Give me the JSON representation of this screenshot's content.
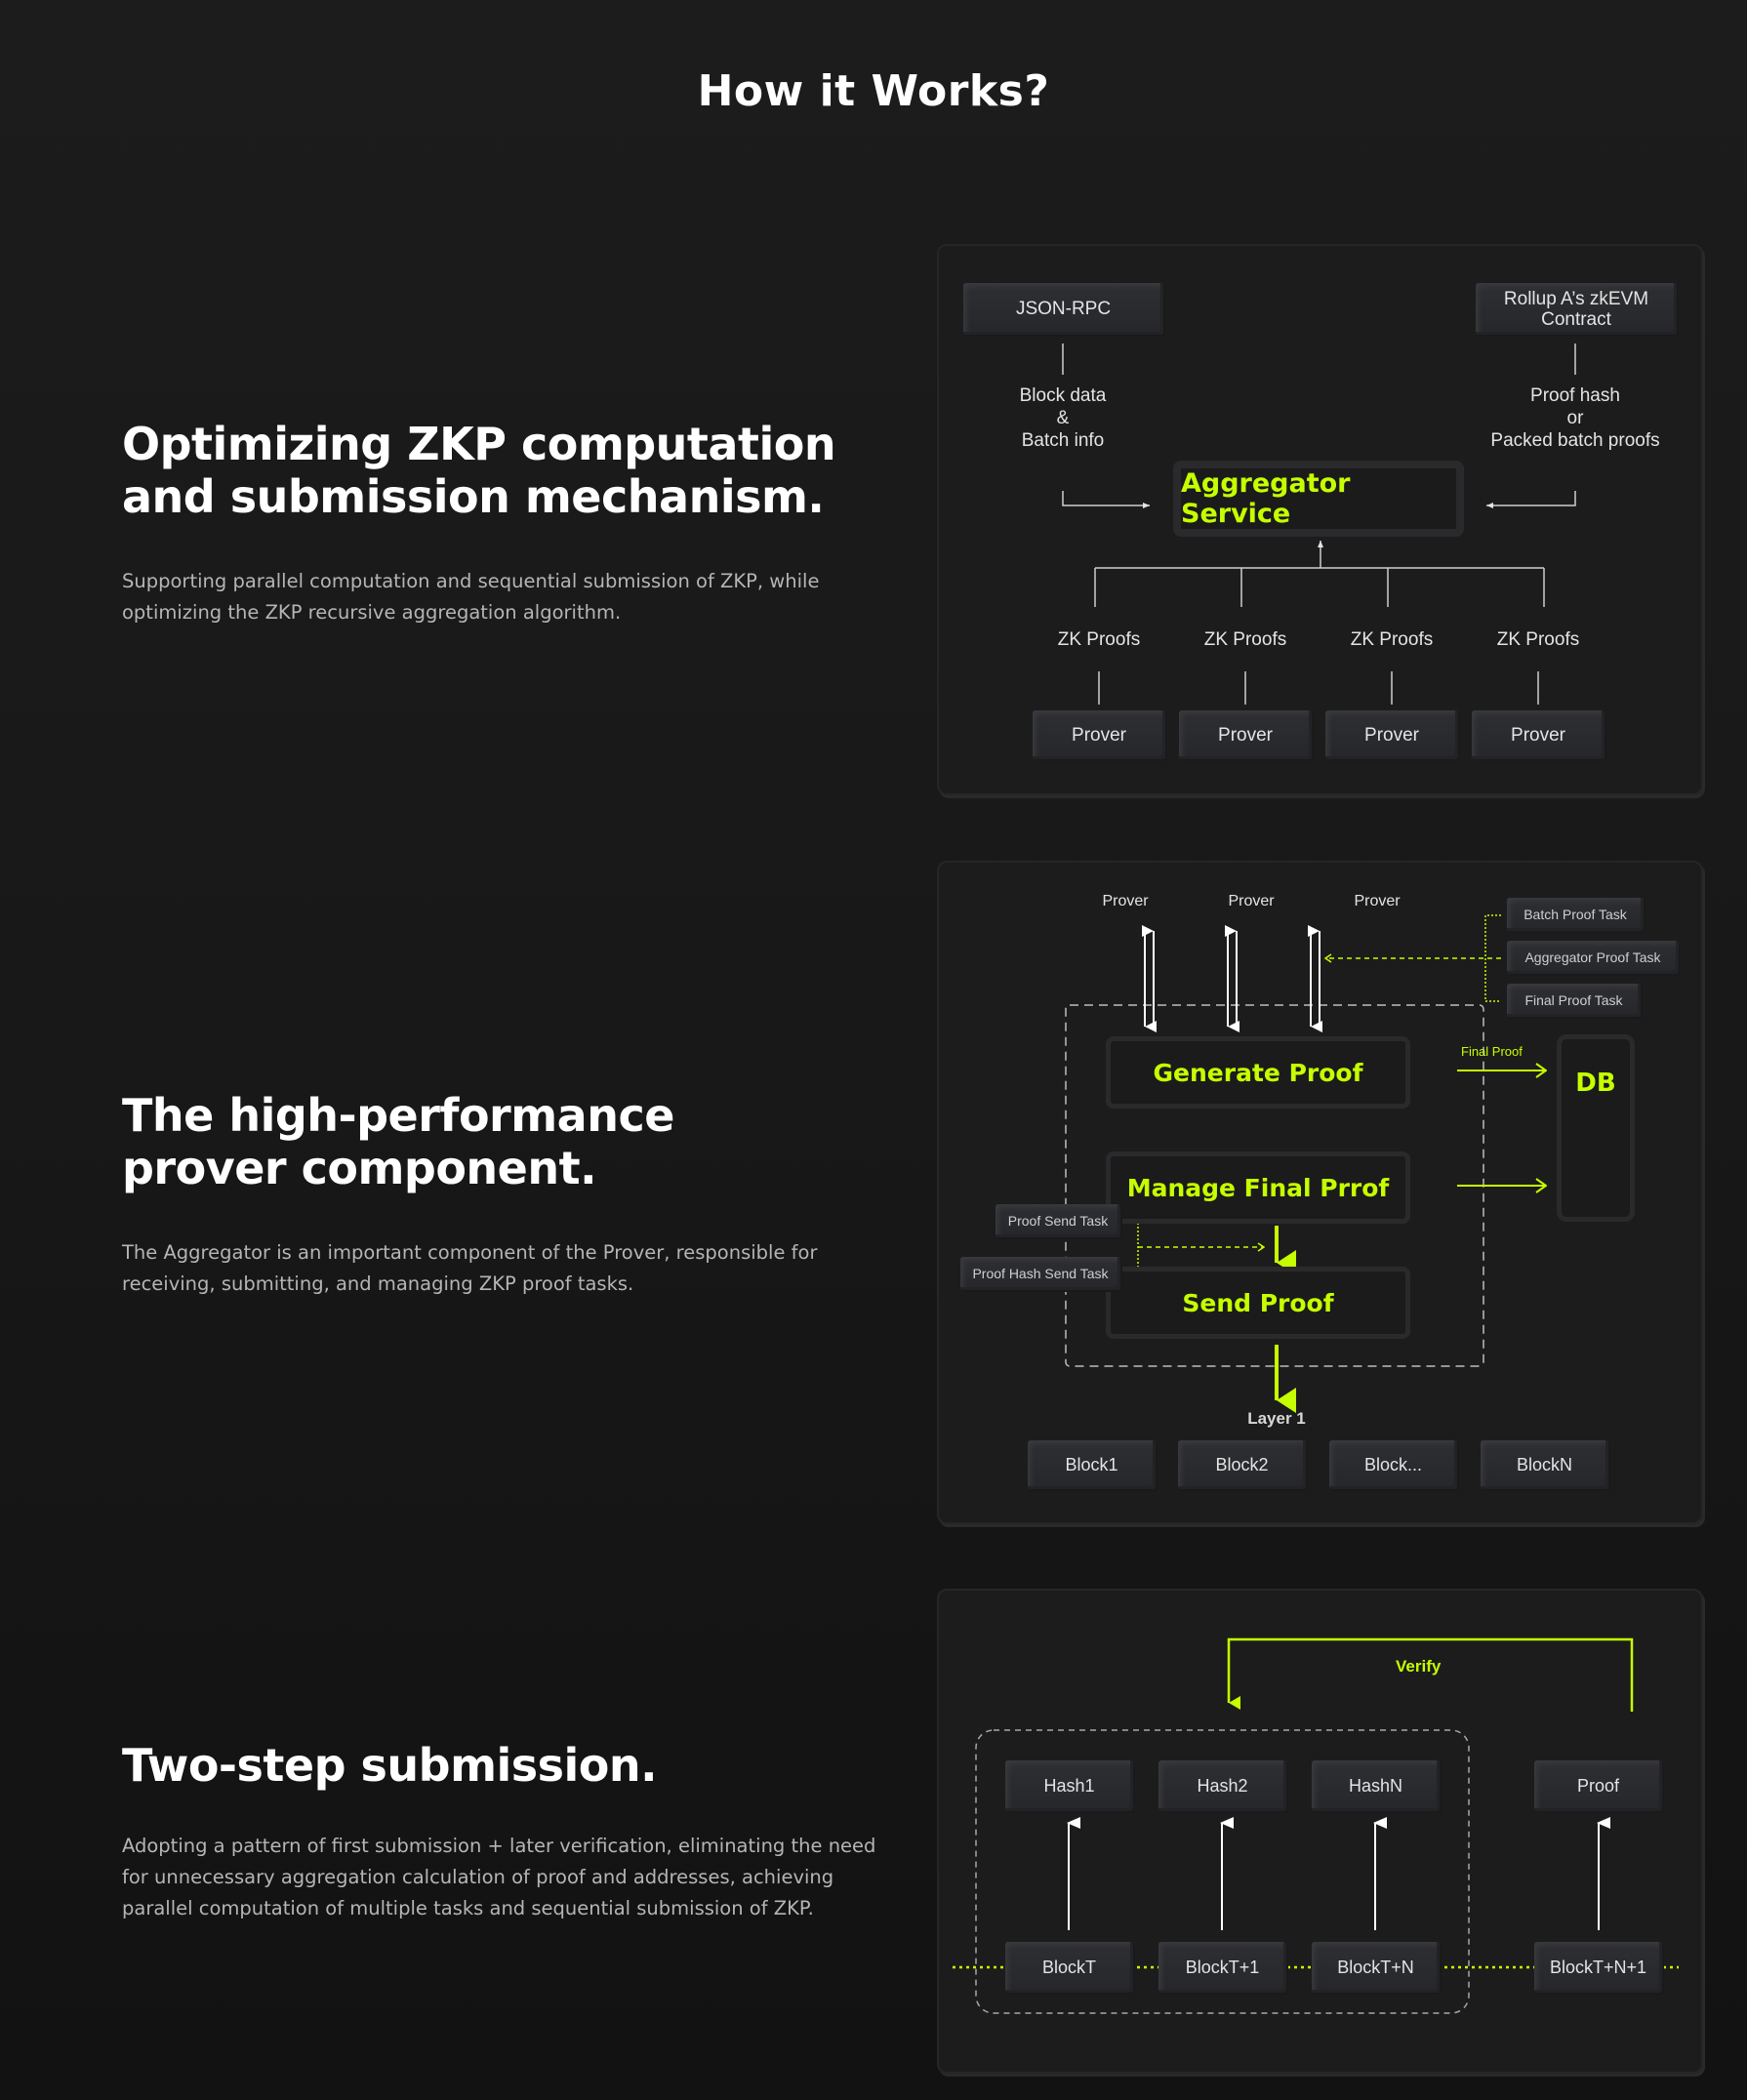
{
  "page": {
    "title": "How it Works?"
  },
  "colors": {
    "accent": "#c6ff00",
    "background": "#1a1a1a",
    "panel": "#1c1c1c",
    "node": "#2b2c2f",
    "text_muted": "#b5b5b5"
  },
  "sections": [
    {
      "heading": "Optimizing ZKP computation and submission mechanism.",
      "description": "Supporting parallel computation and sequential submission of ZKP, while optimizing the ZKP recursive aggregation algorithm.",
      "diagram": {
        "source_left": "JSON-RPC",
        "source_right": "Rollup A’s zkEVM Contract",
        "left_flow_label": [
          "Block data",
          "&",
          "Batch info"
        ],
        "right_flow_label": [
          "Proof hash",
          "or",
          "Packed batch proofs"
        ],
        "center_node": "Aggregator Service",
        "proof_labels": [
          "ZK Proofs",
          "ZK Proofs",
          "ZK Proofs",
          "ZK Proofs"
        ],
        "provers": [
          "Prover",
          "Prover",
          "Prover",
          "Prover"
        ]
      }
    },
    {
      "heading": "The high-performance prover component.",
      "description": "The Aggregator is an important component of the Prover, responsible for receiving, submitting, and managing ZKP proof tasks.",
      "diagram": {
        "provers": [
          "Prover",
          "Prover",
          "Prover"
        ],
        "task_types": [
          "Batch Proof Task",
          "Aggregator Proof Task",
          "Final Proof Task"
        ],
        "stages": [
          "Generate Proof",
          "Manage Final Prrof",
          "Send Proof"
        ],
        "final_proof_label": "Final Proof",
        "db_label": "DB",
        "send_tasks": [
          "Proof Send Task",
          "Proof Hash Send Task"
        ],
        "layer_label": "Layer 1",
        "blocks": [
          "Block1",
          "Block2",
          "Block...",
          "BlockN"
        ]
      }
    },
    {
      "heading": "Two-step submission.",
      "description": "Adopting a pattern of first submission + later verification, eliminating the need for unnecessary aggregation calculation of proof and addresses, achieving parallel computation of multiple tasks and sequential submission of ZKP.",
      "diagram": {
        "verify_label": "Verify",
        "hashes": [
          "Hash1",
          "Hash2",
          "HashN"
        ],
        "proof": "Proof",
        "blocks": [
          "BlockT",
          "BlockT+1",
          "BlockT+N",
          "BlockT+N+1"
        ]
      }
    }
  ]
}
